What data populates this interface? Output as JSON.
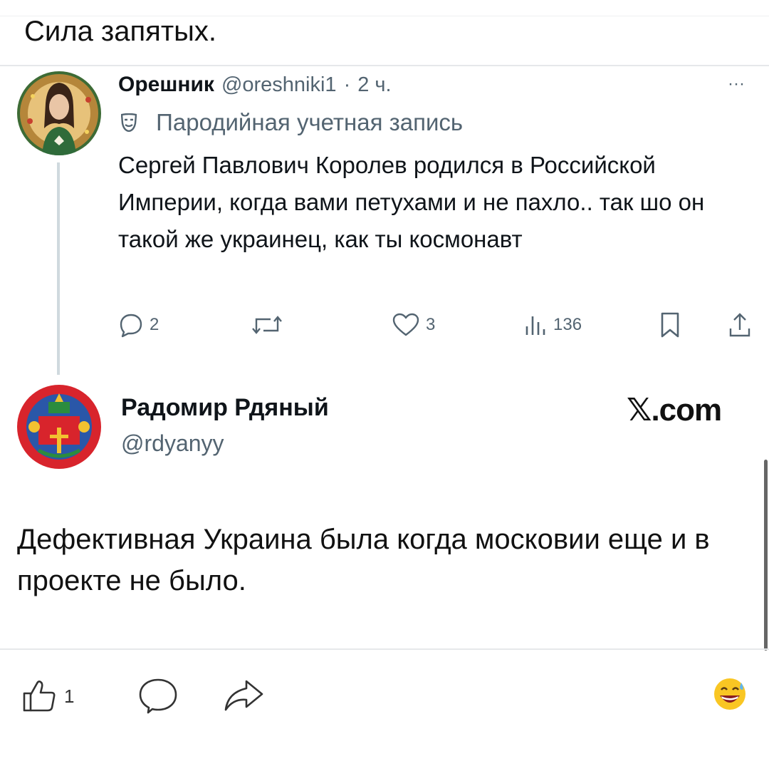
{
  "caption": "Сила запятых.",
  "tweet": {
    "author_name": "Орешник",
    "author_handle": "@oreshniki1",
    "time": "2 ч.",
    "separator": "·",
    "more": "···",
    "badge_text": "Пародийная учетная запись",
    "text": "Сергей Павлович Королев родился в Российской Империи, когда вами петухами и не пахло.. так шо он такой же украинец, как ты космонавт",
    "actions": {
      "replies": "2",
      "likes": "3",
      "views": "136"
    }
  },
  "reply": {
    "author_name": "Радомир Рдяный",
    "author_handle": "@rdyanyy",
    "brand": "𝕏.com",
    "text": "Дефективная Украина была когда московии еще и в проекте не было."
  },
  "footer": {
    "like_count": "1"
  },
  "icons": {
    "reply": "speech-bubble-icon",
    "retweet": "retweet-icon",
    "like": "heart-icon",
    "views": "bar-chart-icon",
    "bookmark": "bookmark-icon",
    "share": "share-icon",
    "badge": "parody-mask-icon",
    "thumbs_up": "thumbs-up-icon",
    "comment": "comment-icon",
    "forward": "forward-arrow-icon",
    "emoji": "grinning-sweat-emoji-icon"
  }
}
